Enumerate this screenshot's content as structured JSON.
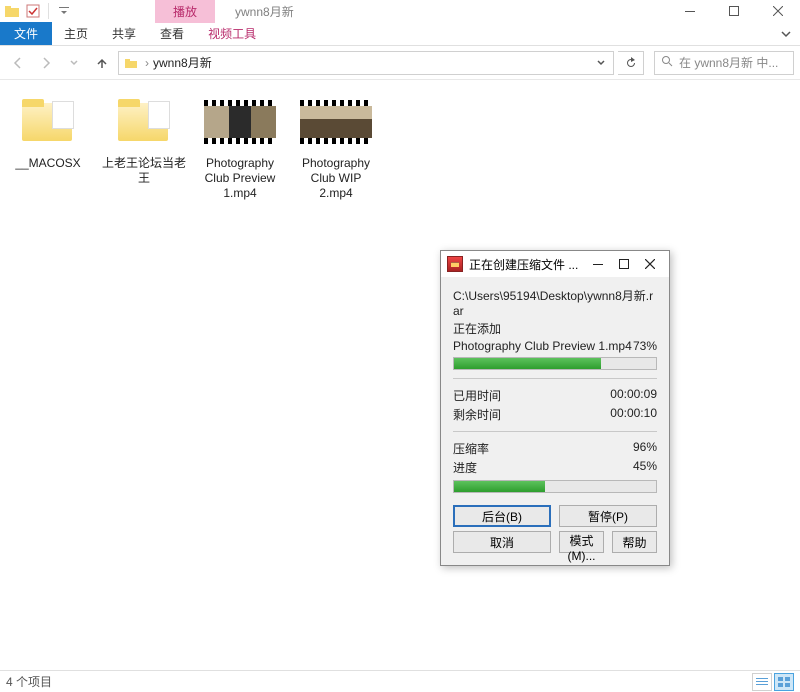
{
  "colors": {
    "ribbon_file": "#1979ca",
    "tab_play": "#f6bfd7"
  },
  "window": {
    "title": "ywnn8月新"
  },
  "ribbon": {
    "play_tab": "播放",
    "file": "文件",
    "tabs": [
      "主页",
      "共享",
      "查看"
    ],
    "video_tab": "视频工具"
  },
  "nav": {
    "breadcrumb": [
      "ywnn8月新"
    ],
    "search_placeholder": "在 ywnn8月新 中..."
  },
  "items": [
    {
      "label": "__MACOSX",
      "kind": "folder"
    },
    {
      "label": "上老王论坛当老王",
      "kind": "folder"
    },
    {
      "label": "Photography Club Preview 1.mp4",
      "kind": "video",
      "thumb": "img1"
    },
    {
      "label": "Photography Club WIP 2.mp4",
      "kind": "video",
      "thumb": "img2"
    }
  ],
  "status": {
    "count": "4 个项目"
  },
  "dialog": {
    "title": "正在创建压缩文件 ...",
    "path": "C:\\Users\\95194\\Desktop\\ywnn8月新.rar",
    "adding": "正在添加",
    "current_file": "Photography Club Preview 1.mp4",
    "file_pct": "73%",
    "file_pct_val": 73,
    "elapsed_label": "已用时间",
    "elapsed": "00:00:09",
    "remaining_label": "剩余时间",
    "remaining": "00:00:10",
    "ratio_label": "压缩率",
    "ratio": "96%",
    "progress_label": "进度",
    "progress": "45%",
    "progress_val": 45,
    "buttons": {
      "background": "后台(B)",
      "pause": "暂停(P)",
      "cancel": "取消",
      "mode": "模式(M)...",
      "help": "帮助"
    }
  }
}
